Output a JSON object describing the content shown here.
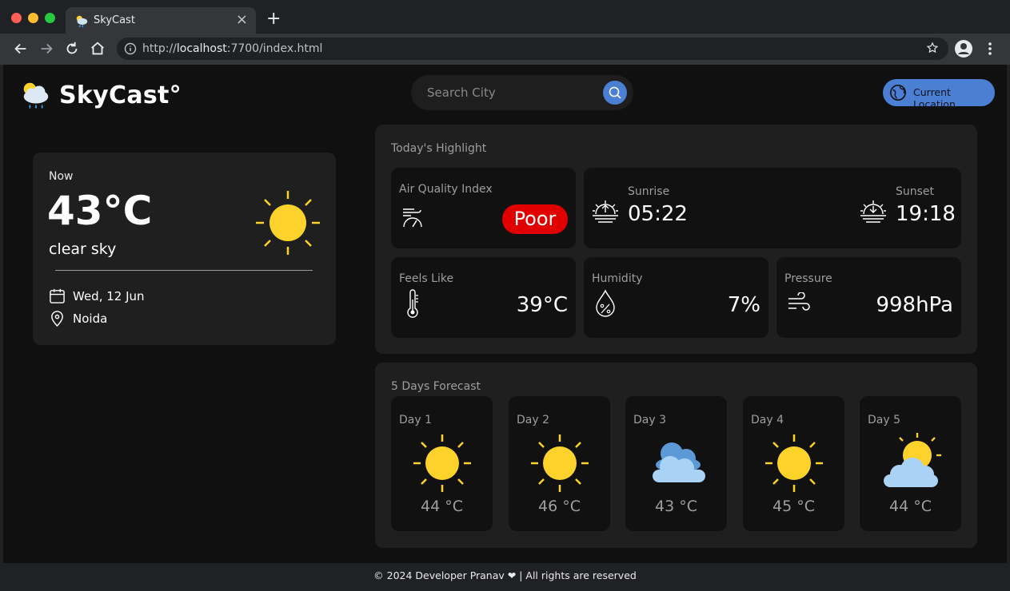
{
  "browser": {
    "tab_title": "SkyCast",
    "url_prefix": "http://",
    "url_host": "localhost",
    "url_rest": ":7700/index.html",
    "tab_close": "×",
    "new_tab": "+"
  },
  "header": {
    "logo_text": "SkyCast°",
    "search_placeholder": "Search City",
    "location_button": "Current Location"
  },
  "now": {
    "label": "Now",
    "temperature": "43°C",
    "description": "clear sky",
    "date": "Wed, 12 Jun",
    "location": "Noida",
    "icon": "sun-icon"
  },
  "highlights": {
    "title": "Today's Highlight",
    "aqi": {
      "label": "Air Quality Index",
      "value": "Poor",
      "color": "#e00000"
    },
    "sunrise": {
      "label": "Sunrise",
      "value": "05:22"
    },
    "sunset": {
      "label": "Sunset",
      "value": "19:18"
    },
    "feels_like": {
      "label": "Feels Like",
      "value": "39°C"
    },
    "humidity": {
      "label": "Humidity",
      "value": "7%"
    },
    "pressure": {
      "label": "Pressure",
      "value": "998hPa"
    }
  },
  "forecast": {
    "title": "5 Days Forecast",
    "days": [
      {
        "label": "Day 1",
        "temp": "44 °C",
        "icon": "sun-icon"
      },
      {
        "label": "Day 2",
        "temp": "46 °C",
        "icon": "sun-icon"
      },
      {
        "label": "Day 3",
        "temp": "43 °C",
        "icon": "cloud-icon"
      },
      {
        "label": "Day 4",
        "temp": "45 °C",
        "icon": "sun-icon"
      },
      {
        "label": "Day 5",
        "temp": "44 °C",
        "icon": "partly-cloudy-icon"
      }
    ]
  },
  "footer": {
    "text": "© 2024 Developer Pranav ❤ | All rights are reserved"
  },
  "colors": {
    "accent": "#4a7fd4",
    "sun": "#fdd22a",
    "danger": "#e00000"
  }
}
